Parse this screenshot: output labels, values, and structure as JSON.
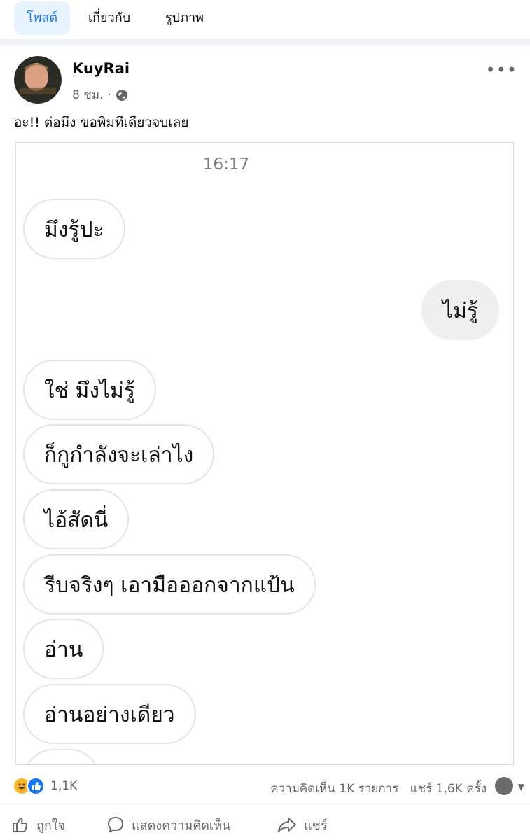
{
  "tabs": [
    {
      "label": "โพสต์"
    },
    {
      "label": "เกี่ยวกับ"
    },
    {
      "label": "รูปภาพ"
    }
  ],
  "post": {
    "author": "KuyRai",
    "time": "8 ชม.",
    "dot": "·",
    "caption": "อะ!! ต่อมึง ขอพิมทีเดียวจบเลย",
    "chat": {
      "timestamp": "16:17",
      "messages": [
        {
          "text": "มึงรู้ปะ",
          "side": "in"
        },
        {
          "text": "ไม่รู้",
          "side": "out"
        },
        {
          "text": "ใช่ มึงไม่รู้",
          "side": "in"
        },
        {
          "text": "ก็กูกำลังจะเล่าไง",
          "side": "in"
        },
        {
          "text": "ไอ้สัดนี่",
          "side": "in"
        },
        {
          "text": "รีบจริงๆ เอามือออกจากแป้น",
          "side": "in"
        },
        {
          "text": "อ่าน",
          "side": "in"
        },
        {
          "text": "อ่านอย่างเดียว",
          "side": "in"
        }
      ]
    },
    "reactions": {
      "count": "1,1K",
      "icons": [
        "haha-icon",
        "like-icon"
      ],
      "comments": "ความคิดเห็น 1K รายการ",
      "shares": "แชร์ 1,6K ครั้ง"
    },
    "actions": {
      "like": "ถูกใจ",
      "comment": "แสดงความคิดเห็น",
      "share": "แชร์"
    }
  },
  "colors": {
    "accent": "#1877f2",
    "tab_active_bg": "#e7f3ff",
    "secondary_text": "#65676b",
    "separator": "#f0f2f5"
  }
}
